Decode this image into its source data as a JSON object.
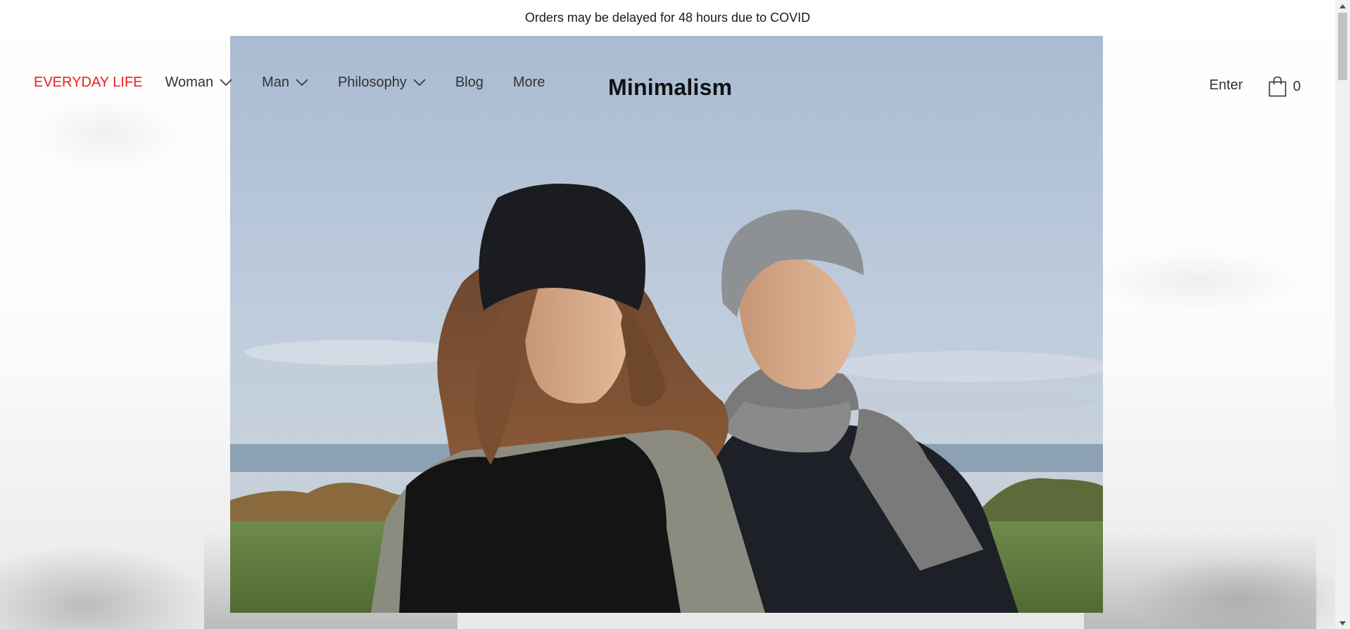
{
  "announcement": {
    "text": "Orders may be delayed for 48 hours due to COVID"
  },
  "header": {
    "logo": "Minimalism",
    "nav": [
      {
        "label": "EVERYDAY LIFE",
        "accent": true,
        "has_dropdown": false
      },
      {
        "label": "Woman",
        "accent": false,
        "has_dropdown": true
      },
      {
        "label": "Man",
        "accent": false,
        "has_dropdown": true
      },
      {
        "label": "Philosophy",
        "accent": false,
        "has_dropdown": true
      },
      {
        "label": "Blog",
        "accent": false,
        "has_dropdown": false
      },
      {
        "label": "More",
        "accent": false,
        "has_dropdown": false
      }
    ],
    "enter_label": "Enter",
    "cart": {
      "icon": "shopping-bag-icon",
      "count": "0"
    }
  },
  "hero": {
    "image": "couple-wearing-knit-beanies-and-scarves-by-the-sea"
  },
  "colors": {
    "accent": "#ee1c1c",
    "text": "#333333",
    "logo": "#111111"
  }
}
